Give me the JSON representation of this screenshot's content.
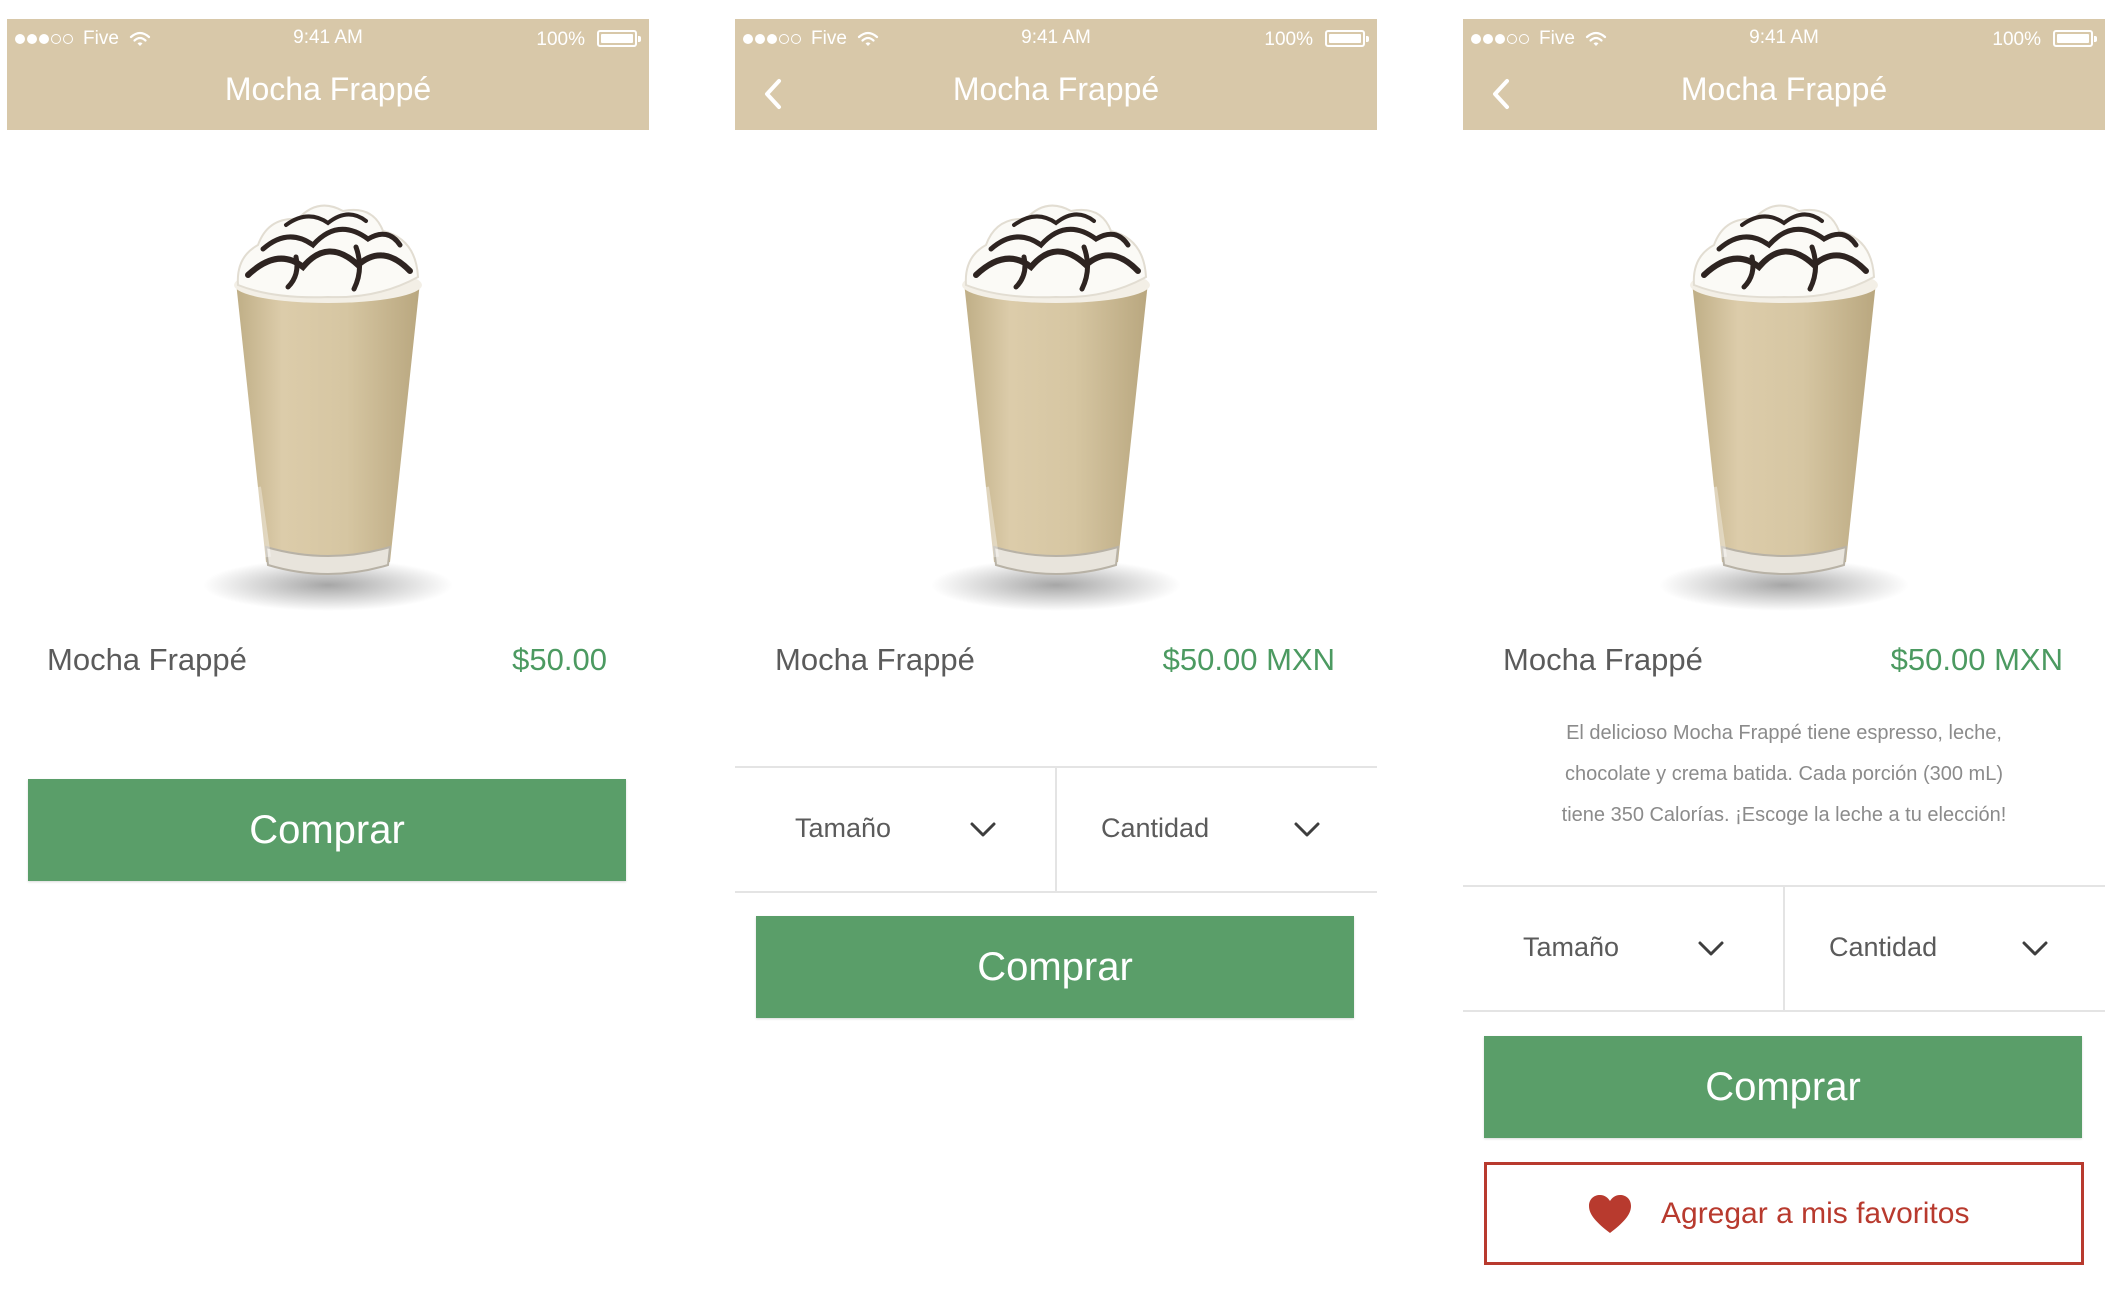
{
  "status_bar": {
    "carrier": "Five",
    "time": "9:41 AM",
    "battery": "100%"
  },
  "screens": [
    {
      "nav_title": "Mocha Frappé",
      "product_name": "Mocha Frappé",
      "price": "$50.00",
      "buy_label": "Comprar"
    },
    {
      "nav_title": "Mocha Frappé",
      "product_name": "Mocha Frappé",
      "price": "$50.00 MXN",
      "size_label": "Tamaño",
      "quantity_label": "Cantidad",
      "buy_label": "Comprar"
    },
    {
      "nav_title": "Mocha Frappé",
      "product_name": "Mocha Frappé",
      "price": "$50.00 MXN",
      "description_lines": [
        "El delicioso Mocha Frappé tiene espresso, leche,",
        "chocolate y crema batida. Cada porción (300 mL)",
        "tiene 350 Calorías. ¡Escoge la leche a tu elección!"
      ],
      "size_label": "Tamaño",
      "quantity_label": "Cantidad",
      "buy_label": "Comprar",
      "favorite_label": "Agregar a mis favoritos"
    }
  ],
  "icons": {
    "back": "chevron-left-icon",
    "dropdown": "chevron-down-icon",
    "favorite": "heart-icon",
    "wifi": "wifi-icon",
    "battery": "battery-icon"
  },
  "colors": {
    "navbar": "#d8c8a9",
    "price": "#4c9a61",
    "buy_button": "#5a9e69",
    "favorite": "#b83a2e"
  }
}
